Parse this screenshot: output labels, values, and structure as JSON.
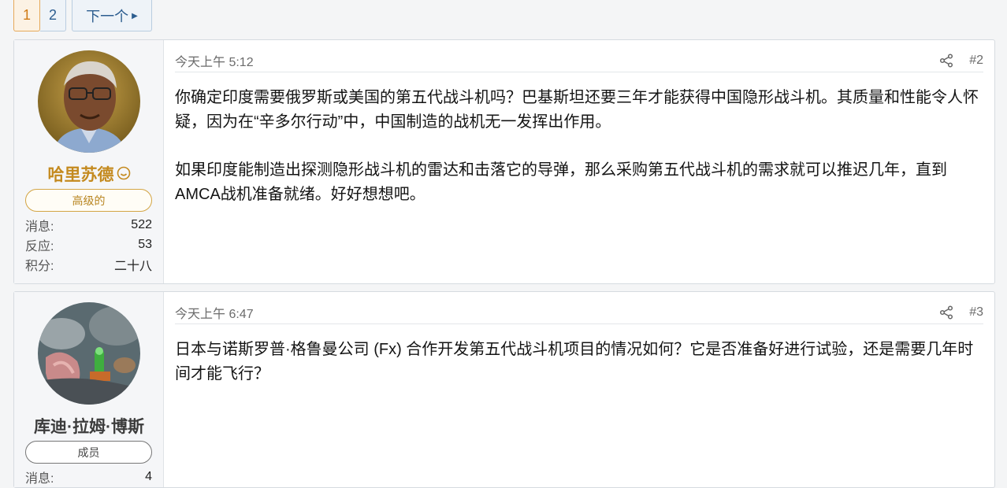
{
  "pagination": {
    "current": "1",
    "page2": "2",
    "next": "下一个"
  },
  "posts": [
    {
      "author": "哈里苏德",
      "role": "高级的",
      "stats": [
        {
          "label": "消息:",
          "value": "522"
        },
        {
          "label": "反应:",
          "value": "53"
        },
        {
          "label": "积分:",
          "value": "二十八"
        }
      ],
      "time": "今天上午 5:12",
      "number": "#2",
      "paragraphs": [
        "你确定印度需要俄罗斯或美国的第五代战斗机吗？巴基斯坦还要三年才能获得中国隐形战斗机。其质量和性能令人怀疑，因为在“辛多尔行动”中，中国制造的战机无一发挥出作用。",
        "如果印度能制造出探测隐形战斗机的雷达和击落它的导弹，那么采购第五代战斗机的需求就可以推迟几年，直到AMCA战机准备就绪。好好想想吧。"
      ]
    },
    {
      "author": "库迪·拉姆·博斯",
      "role": "成员",
      "stats": [
        {
          "label": "消息:",
          "value": "4"
        }
      ],
      "time": "今天上午 6:47",
      "number": "#3",
      "paragraphs": [
        "日本与诺斯罗普·格鲁曼公司 (Fx) 合作开发第五代战斗机项目的情况如何？它是否准备好进行试验，还是需要几年时间才能飞行？"
      ]
    }
  ]
}
